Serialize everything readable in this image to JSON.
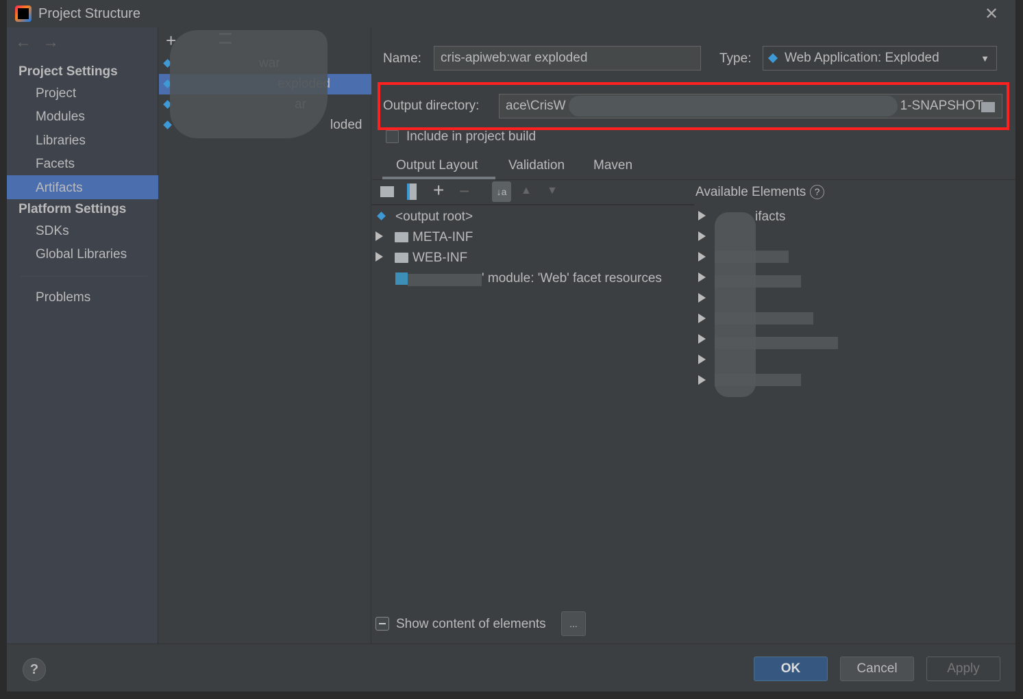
{
  "window": {
    "title": "Project Structure"
  },
  "sidebar": {
    "section1": "Project Settings",
    "items1": [
      "Project",
      "Modules",
      "Libraries",
      "Facets",
      "Artifacts"
    ],
    "section2": "Platform Settings",
    "items2": [
      "SDKs",
      "Global Libraries"
    ],
    "problems": "Problems",
    "selected": "Artifacts"
  },
  "artifacts": {
    "items": [
      "war",
      "exploded",
      "ar",
      "loded"
    ],
    "selected_index": 1
  },
  "form": {
    "name_label": "Name:",
    "name_value": "cris-apiweb:war exploded",
    "type_label": "Type:",
    "type_value": "Web Application: Exploded",
    "output_label": "Output directory:",
    "output_start": "ace\\CrisW",
    "output_end": "1-SNAPSHOT",
    "include_label": "Include in project build",
    "include_checked": false
  },
  "tabs": [
    "Output Layout",
    "Validation",
    "Maven"
  ],
  "active_tab": "Output Layout",
  "layout_tree": [
    "<output root>",
    "META-INF",
    "WEB-INF",
    "' module: 'Web' facet resources"
  ],
  "available": {
    "title": "Available Elements",
    "first": "ifacts"
  },
  "show_content": {
    "label": "Show content of elements",
    "more": "..."
  },
  "buttons": {
    "ok": "OK",
    "cancel": "Cancel",
    "apply": "Apply",
    "help": "?"
  },
  "colors": {
    "selection": "#4b6eaf",
    "highlight_box": "#ff2020",
    "background": "#3c3f41"
  }
}
